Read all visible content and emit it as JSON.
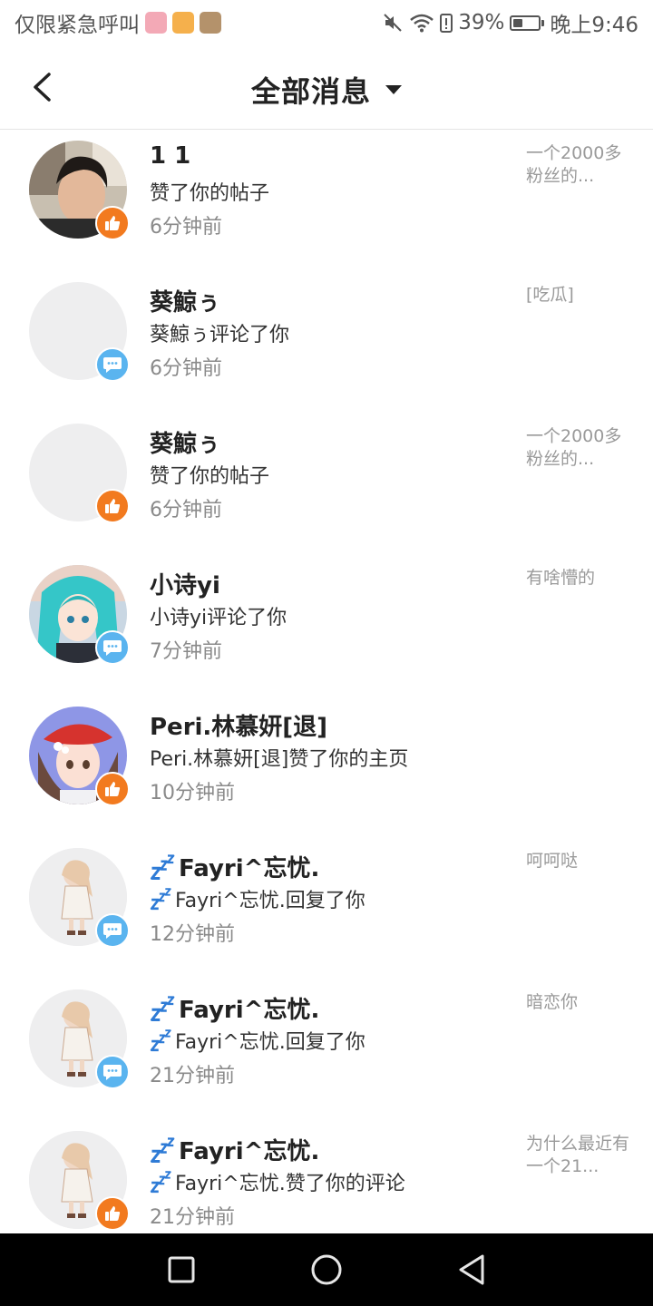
{
  "status_bar": {
    "carrier": "仅限紧急呼叫",
    "battery": "39%",
    "battery_level": 0.39,
    "time": "晚上9:46"
  },
  "header": {
    "title": "全部消息"
  },
  "messages": [
    {
      "name": "1 1",
      "action": "赞了你的帖子",
      "time": "6分钟前",
      "preview": "一个2000多粉丝的...",
      "type": "like",
      "avatar": "photo"
    },
    {
      "name": "葵鯨ぅ",
      "action": "葵鯨ぅ评论了你",
      "time": "6分钟前",
      "preview": "[吃瓜]",
      "type": "comment",
      "avatar": "blank"
    },
    {
      "name": "葵鯨ぅ",
      "action": "赞了你的帖子",
      "time": "6分钟前",
      "preview": "一个2000多粉丝的...",
      "type": "like",
      "avatar": "blank"
    },
    {
      "name": "小诗yi",
      "action": "小诗yi评论了你",
      "time": "7分钟前",
      "preview": "有啥懵的",
      "type": "comment",
      "avatar": "anime-teal"
    },
    {
      "name": "Peri.林慕妍[退]",
      "action": "Peri.林慕妍[退]赞了你的主页",
      "time": "10分钟前",
      "preview": "",
      "type": "like",
      "avatar": "anime-red-hat"
    },
    {
      "name": "Fayri^忘忧.",
      "action": "Fayri^忘忧.回复了你",
      "time": "12分钟前",
      "preview": "呵呵哒",
      "type": "comment",
      "avatar": "chibi"
    },
    {
      "name": "Fayri^忘忧.",
      "action": "Fayri^忘忧.回复了你",
      "time": "21分钟前",
      "preview": "暗恋你",
      "type": "comment",
      "avatar": "chibi"
    },
    {
      "name": "Fayri^忘忧.",
      "action": "Fayri^忘忧.赞了你的评论",
      "time": "21分钟前",
      "preview": "为什么最近有一个21...",
      "type": "like",
      "avatar": "chibi"
    }
  ]
}
